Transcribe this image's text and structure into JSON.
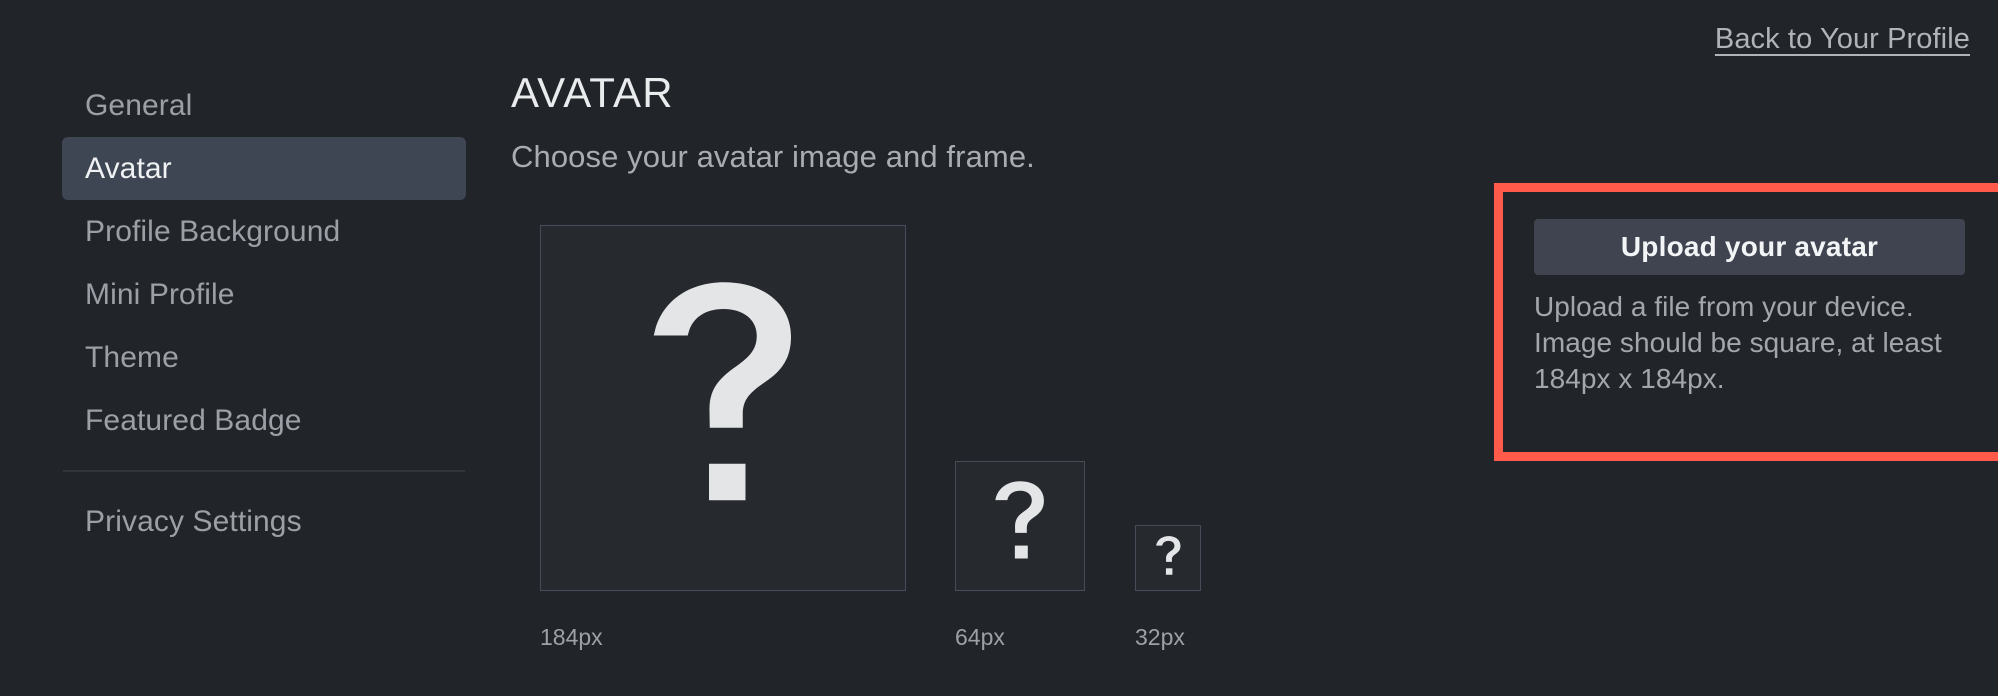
{
  "header": {
    "back_link": "Back to Your Profile"
  },
  "sidebar": {
    "items": [
      {
        "label": "General",
        "active": false
      },
      {
        "label": "Avatar",
        "active": true
      },
      {
        "label": "Profile Background",
        "active": false
      },
      {
        "label": "Mini Profile",
        "active": false
      },
      {
        "label": "Theme",
        "active": false
      },
      {
        "label": "Featured Badge",
        "active": false
      }
    ],
    "divider_after_index": 5,
    "footer_items": [
      {
        "label": "Privacy Settings",
        "active": false
      }
    ]
  },
  "main": {
    "title": "AVATAR",
    "subtitle": "Choose your avatar image and frame.",
    "previews": [
      {
        "size_label": "184px",
        "placeholder_icon": "question-mark-icon"
      },
      {
        "size_label": "64px",
        "placeholder_icon": "question-mark-icon"
      },
      {
        "size_label": "32px",
        "placeholder_icon": "question-mark-icon"
      }
    ]
  },
  "upload": {
    "button_label": "Upload your avatar",
    "help_text": "Upload a file from your device. Image should be square, at least 184px x 184px."
  },
  "colors": {
    "page_background": "#212428",
    "active_nav_background": "#3f4653",
    "button_background": "#3f4450",
    "highlight_outline": "#ff5a4a",
    "text_primary": "#e9ebed",
    "text_muted": "#9ca0a6",
    "preview_box_background": "#26292e",
    "preview_box_border": "#474d58"
  }
}
